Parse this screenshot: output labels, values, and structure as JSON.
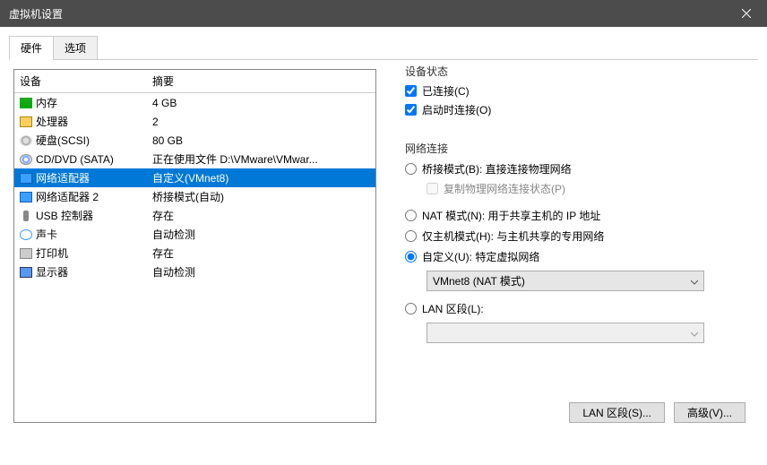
{
  "title": "虚拟机设置",
  "tabs": {
    "hardware": "硬件",
    "options": "选项"
  },
  "list": {
    "col_device": "设备",
    "col_summary": "摘要",
    "rows": [
      {
        "icon": "memory-icon",
        "name": "内存",
        "summary": "4 GB"
      },
      {
        "icon": "cpu-icon",
        "name": "处理器",
        "summary": "2"
      },
      {
        "icon": "disk-icon",
        "name": "硬盘(SCSI)",
        "summary": "80 GB"
      },
      {
        "icon": "cd-icon",
        "name": "CD/DVD (SATA)",
        "summary": "正在使用文件 D:\\VMware\\VMwar..."
      },
      {
        "icon": "network-icon",
        "name": "网络适配器",
        "summary": "自定义(VMnet8)"
      },
      {
        "icon": "network-icon",
        "name": "网络适配器 2",
        "summary": "桥接模式(自动)"
      },
      {
        "icon": "usb-icon",
        "name": "USB 控制器",
        "summary": "存在"
      },
      {
        "icon": "sound-icon",
        "name": "声卡",
        "summary": "自动检测"
      },
      {
        "icon": "printer-icon",
        "name": "打印机",
        "summary": "存在"
      },
      {
        "icon": "monitor-icon",
        "name": "显示器",
        "summary": "自动检测"
      }
    ],
    "selected_index": 4
  },
  "device_state": {
    "legend": "设备状态",
    "connected": "已连接(C)",
    "connect_on_poweron": "启动时连接(O)"
  },
  "net": {
    "legend": "网络连接",
    "bridged": "桥接模式(B): 直接连接物理网络",
    "replicate": "复制物理网络连接状态(P)",
    "nat": "NAT 模式(N): 用于共享主机的 IP 地址",
    "hostonly": "仅主机模式(H): 与主机共享的专用网络",
    "custom": "自定义(U): 特定虚拟网络",
    "custom_value": "VMnet8 (NAT 模式)",
    "lan_segment": "LAN 区段(L):",
    "lan_segment_value": ""
  },
  "buttons": {
    "lan_segments": "LAN 区段(S)...",
    "advanced": "高级(V)..."
  }
}
